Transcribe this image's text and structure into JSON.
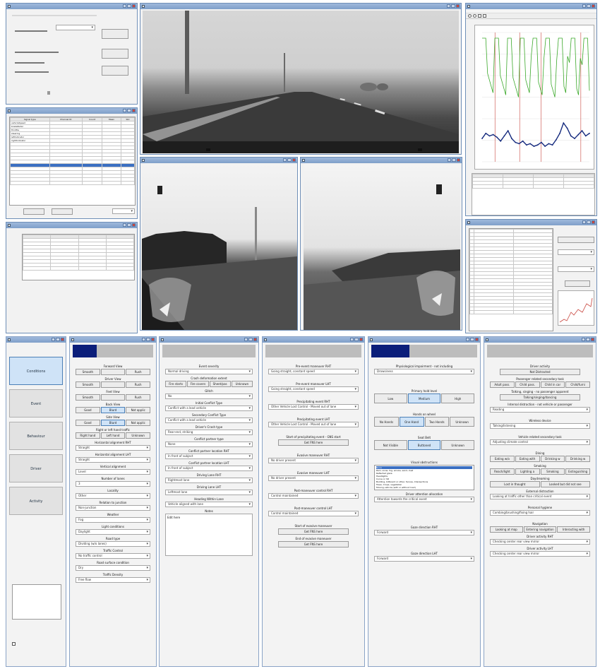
{
  "colors": {
    "accent": "#0b1e7a",
    "select": "#3b6fc2",
    "green": "#3aa829",
    "blue": "#152a7e",
    "red": "#c9473f"
  },
  "win_control": {
    "title": "",
    "label": "",
    "select": "",
    "btn1": "",
    "btn2": "",
    "btn3": "",
    "info1": "",
    "info2": "",
    "info3": ""
  },
  "sidebar": {
    "items": [
      {
        "label": "Conditions"
      },
      {
        "label": "Event"
      },
      {
        "label": "Behaviour"
      },
      {
        "label": "Driver"
      },
      {
        "label": "Activity"
      }
    ],
    "checkbox": ""
  },
  "panel1": {
    "sections": [
      {
        "label": "Forward View",
        "buttons": [
          "Smooth",
          "",
          "Rush"
        ]
      },
      {
        "label": "Driver View",
        "buttons": [
          "Smooth",
          "",
          "Rush"
        ]
      },
      {
        "label": "Feet View",
        "buttons": [
          "Smooth",
          "",
          "Rush"
        ]
      },
      {
        "label": "Back View",
        "buttons": [
          "Good",
          "Blurd",
          "Not applic"
        ]
      },
      {
        "label": "Side View",
        "buttons": [
          "Good",
          "Blurd",
          "Not applic"
        ]
      },
      {
        "label": "Right or left hand traffic",
        "buttons": [
          "Right hand",
          "Left hand",
          "Unknown"
        ]
      }
    ],
    "dropdowns": [
      {
        "label": "Horizontal alignment RHT",
        "value": "Straight"
      },
      {
        "label": "Horizontal alignment LHT",
        "value": "Straight"
      },
      {
        "label": "Vertical alignment",
        "value": "Level"
      },
      {
        "label": "Number of lanes",
        "value": "3"
      },
      {
        "label": "Locality",
        "value": "Other"
      },
      {
        "label": "Relation to junction",
        "value": "Non-junction"
      },
      {
        "label": "Weather",
        "value": "Fog"
      },
      {
        "label": "Light conditions",
        "value": "Daylight"
      },
      {
        "label": "Road type",
        "value": "Dividing (w/o lanes)"
      },
      {
        "label": "Traffic Control",
        "value": "No traffic control"
      },
      {
        "label": "Road surface condition",
        "value": "Dry"
      },
      {
        "label": "Traffic Density",
        "value": "Free flow"
      }
    ]
  },
  "panel2": {
    "dropdowns": [
      {
        "label": "Event severity",
        "value": "Normal driving"
      },
      {
        "label": "Crash deformation extent",
        "value": ""
      },
      {
        "label": "Glitch",
        "value": "No"
      },
      {
        "label": "Initial Conflict Type",
        "value": "Conflict with a lead vehicle"
      },
      {
        "label": "Secondary Conflict Type",
        "value": "Conflict with a lead vehicle"
      },
      {
        "label": "Driver's Crash type",
        "value": "Rear-end, striking"
      },
      {
        "label": "Conflict partner type",
        "value": "None"
      },
      {
        "label": "Conflict partner location RHT",
        "value": "In front of subject"
      },
      {
        "label": "Conflict partner location LHT",
        "value": "In front of subject"
      },
      {
        "label": "Driving Lane RHT",
        "value": "Rightmost lane"
      },
      {
        "label": "Driving Lane LHT",
        "value": "Leftmost lane"
      },
      {
        "label": "Heading Within Lane",
        "value": "Vehicle aligned with lane"
      }
    ],
    "crash_buttons": [
      "Fire starts",
      "Fire covers",
      "Sheet/pas",
      "Unknown"
    ],
    "notes_label": "Notes",
    "notes_value": "Edit here"
  },
  "panel3": {
    "dropdowns": [
      {
        "label": "Pre-event maneuver RHT",
        "value": "Going straight, constant speed"
      },
      {
        "label": "Pre-event maneuver LHT",
        "value": "Going straight, constant speed"
      },
      {
        "label": "Precipitating event RHT",
        "value": "Other Vehicle Lost Control - Moved out of lane"
      },
      {
        "label": "Precipitating event LHT",
        "value": "Other Vehicle Lost Control - Moved out of lane"
      }
    ],
    "start_label": "Start of precipitating event - GNS start",
    "start_btn": "Get FNS here",
    "dropdowns2": [
      {
        "label": "Evasive maneuver RHT",
        "value": "No driver present"
      },
      {
        "label": "Evasive maneuver LHT",
        "value": "No driver present"
      },
      {
        "label": "Post-maneuver control RHT",
        "value": "Control maintained"
      },
      {
        "label": "Post-maneuver control LHT",
        "value": "Control maintained"
      }
    ],
    "evasive_start_label": "Start of evasive maneuver",
    "evasive_start_btn": "Get FNS here",
    "evasive_end_label": "End of evasive maneuver",
    "evasive_end_btn": "Get FNS here"
  },
  "panel4": {
    "impairment_label": "Physiological impairment - not including",
    "impairment_value": "Drowsiness",
    "hold_label": "Primary hold level",
    "hold_buttons": [
      "Low",
      "Medium",
      "High"
    ],
    "hands_label": "Hands on wheel",
    "hands_buttons": [
      "No Hands",
      "One Hand",
      "Two Hands",
      "Unknown"
    ],
    "seat_label": "Seat Belt",
    "seat_buttons": [
      "Not Visible",
      "Buttoned",
      "Unknown"
    ],
    "visual_label": "Visual obstructions",
    "visual_items": [
      "None",
      "Rain, snow, fog, smoke, sand, dust",
      "Reflected glare",
      "Headlights",
      "Curve or hill",
      "Building, billboard or other, fences, Intersections",
      "Trees, Crops, vegetation",
      "Moving vehicle (with or without load)",
      "Parked vehicle"
    ],
    "attention_label": "Driver attention allocation",
    "attention_value": "Attention towards the critical event",
    "gaze_rht_label": "Gaze direction RHT",
    "gaze_rht_value": "Forward",
    "gaze_lht_label": "Gaze direction LHT",
    "gaze_lht_value": "Forward"
  },
  "panel5": {
    "activity_label": "Driver activity",
    "activity_btn": "Not Distracted",
    "pass_label": "Passenger related secondary task",
    "pass_buttons": [
      "Adult pass.",
      "Child pass.",
      "Child in car",
      "Child/furni"
    ],
    "talk_label": "Talking, singing - no passenger apparent",
    "talk_btn": "Talking/singing/dancing",
    "internal_label": "Internal distraction - not vehicle or passenger",
    "internal_value": "Reading",
    "wireless_label": "Wireless device",
    "wireless_value": "Talking/listening",
    "vehicle_label": "Vehicle related secondary task",
    "vehicle_value": "Adjusting climate control",
    "dining_label": "Dining",
    "dining_buttons": [
      "Eating w/o",
      "Eating with",
      "Drinking w",
      "Drinking w"
    ],
    "smoking_label": "Smoking",
    "smoking_buttons": [
      "Reach/Iight",
      "Lighting a",
      "Smoking",
      "Extinguishing"
    ],
    "daydream_label": "Daydreaming",
    "daydream_buttons": [
      "Lost in thought",
      "Looked but did not see"
    ],
    "external_label": "External distraction",
    "external_value": "Looking at traffic other than critical event",
    "hygiene_label": "Personal hygiene",
    "hygiene_value": "Combing/brushing/fixing hair",
    "nav_label": "Navigation",
    "nav_buttons": [
      "Looking at map",
      "Entering navigation",
      "Interacting with"
    ],
    "rht_label": "Driver activity RHT",
    "rht_value": "Checking center rear view mirror",
    "lht_label": "Driver activity LHT",
    "lht_value": "Checking center rear view mirror"
  },
  "list_table": {
    "headers": [
      "Signal type",
      "Channel ID",
      "Count",
      "Mean",
      "Std"
    ],
    "rows": [
      [
        "vehicleSpeed",
        "",
        "",
        "",
        ""
      ],
      [
        "brakePedal",
        "",
        "",
        "",
        ""
      ],
      [
        "throttle",
        "",
        "",
        "",
        ""
      ],
      [
        "steering",
        "",
        "",
        "",
        ""
      ],
      [
        "leftIndicator",
        "",
        "",
        "",
        ""
      ],
      [
        "rightIndicator",
        "",
        "",
        "",
        ""
      ],
      [
        "",
        "",
        "",
        "",
        ""
      ],
      [
        "",
        "",
        "",
        "",
        ""
      ],
      [
        "",
        "",
        "",
        "",
        ""
      ],
      [
        "",
        "",
        "",
        "",
        ""
      ],
      [
        "",
        "",
        "",
        "",
        ""
      ],
      [
        "",
        "",
        "",
        "",
        ""
      ],
      [
        "",
        "",
        "",
        "",
        ""
      ],
      [
        "",
        "",
        "",
        "",
        ""
      ],
      [
        "",
        "",
        "",
        "",
        ""
      ],
      [
        "",
        "",
        "",
        "",
        ""
      ],
      [
        "",
        "",
        "",
        "",
        ""
      ],
      [
        "",
        "",
        "",
        "",
        ""
      ]
    ]
  },
  "signal_list": {
    "items": [
      "",
      "",
      "",
      "",
      "",
      "",
      "",
      "",
      "",
      "",
      "",
      "",
      "",
      "",
      "",
      "",
      "",
      "",
      "",
      "",
      "",
      "",
      "",
      ""
    ]
  },
  "chart_data": {
    "type": "line",
    "series": [
      {
        "values": [
          0.18,
          0.22,
          0.2,
          0.21,
          0.19,
          0.16,
          0.2,
          0.24,
          0.18,
          0.15,
          0.14,
          0.16,
          0.13,
          0.14,
          0.12,
          0.13,
          0.15,
          0.12,
          0.14,
          0.13,
          0.17,
          0.22,
          0.3,
          0.26,
          0.2,
          0.18,
          0.21,
          0.24,
          0.2,
          0.22
        ]
      }
    ],
    "ylim": [
      0,
      1
    ]
  }
}
